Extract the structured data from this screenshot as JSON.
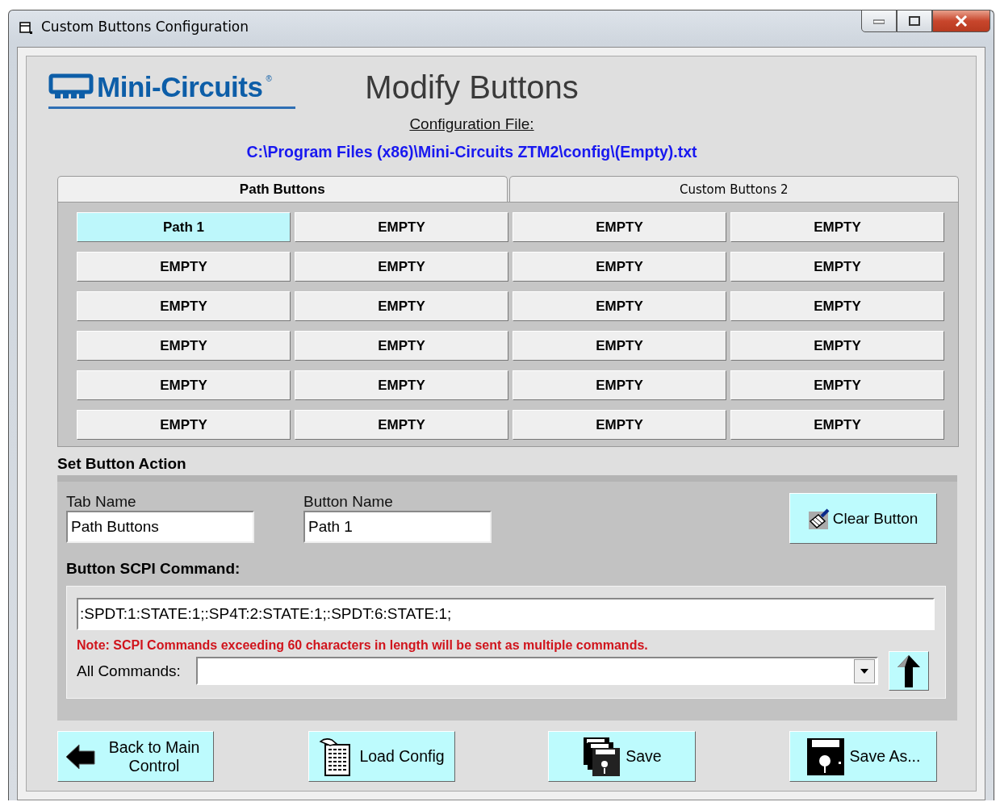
{
  "window": {
    "title": "Custom Buttons Configuration"
  },
  "logo": {
    "text": "Mini-Circuits",
    "mark": "®"
  },
  "heading": "Modify Buttons",
  "config_label": "Configuration File:",
  "config_path": "C:\\Program Files (x86)\\Mini-Circuits ZTM2\\config\\(Empty).txt",
  "tabs": [
    {
      "label": "Path Buttons",
      "selected": true
    },
    {
      "label": "Custom Buttons 2",
      "selected": false
    }
  ],
  "path_buttons": [
    {
      "label": "Path 1",
      "selected": true
    },
    {
      "label": "EMPTY",
      "selected": false
    },
    {
      "label": "EMPTY",
      "selected": false
    },
    {
      "label": "EMPTY",
      "selected": false
    },
    {
      "label": "EMPTY",
      "selected": false
    },
    {
      "label": "EMPTY",
      "selected": false
    },
    {
      "label": "EMPTY",
      "selected": false
    },
    {
      "label": "EMPTY",
      "selected": false
    },
    {
      "label": "EMPTY",
      "selected": false
    },
    {
      "label": "EMPTY",
      "selected": false
    },
    {
      "label": "EMPTY",
      "selected": false
    },
    {
      "label": "EMPTY",
      "selected": false
    },
    {
      "label": "EMPTY",
      "selected": false
    },
    {
      "label": "EMPTY",
      "selected": false
    },
    {
      "label": "EMPTY",
      "selected": false
    },
    {
      "label": "EMPTY",
      "selected": false
    },
    {
      "label": "EMPTY",
      "selected": false
    },
    {
      "label": "EMPTY",
      "selected": false
    },
    {
      "label": "EMPTY",
      "selected": false
    },
    {
      "label": "EMPTY",
      "selected": false
    },
    {
      "label": "EMPTY",
      "selected": false
    },
    {
      "label": "EMPTY",
      "selected": false
    },
    {
      "label": "EMPTY",
      "selected": false
    },
    {
      "label": "EMPTY",
      "selected": false
    }
  ],
  "action": {
    "title": "Set Button Action",
    "tab_name": {
      "label": "Tab Name",
      "value": "Path Buttons"
    },
    "button_name": {
      "label": "Button Name",
      "value": "Path 1"
    },
    "clear_button": "Clear Button",
    "scpi_label": "Button SCPI Command:",
    "scpi_value": ":SPDT:1:STATE:1;:SP4T:2:STATE:1;:SPDT:6:STATE:1;",
    "note": "Note: SCPI Commands exceeding 60 characters in length will be sent as multiple commands.",
    "all_commands_label": "All Commands:"
  },
  "footer_buttons": [
    {
      "label": "Back to Main Control",
      "kind": "back"
    },
    {
      "label": "Load Config",
      "kind": "load"
    },
    {
      "label": "Save",
      "kind": "save"
    },
    {
      "label": "Save As...",
      "kind": "save_as"
    }
  ]
}
